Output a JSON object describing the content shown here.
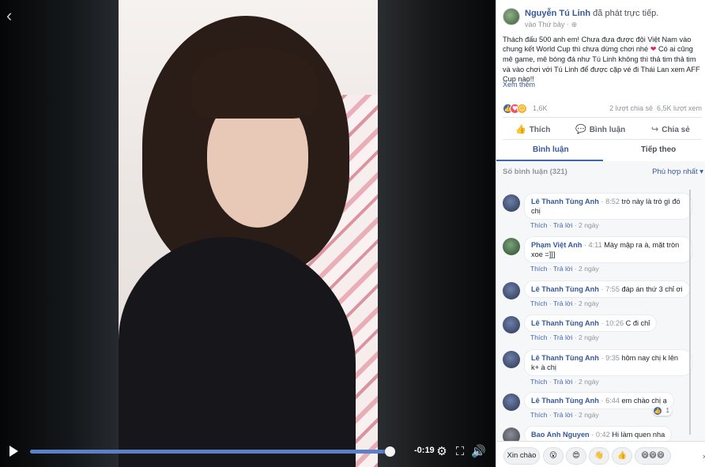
{
  "video": {
    "time_remaining": "-0:19",
    "progress_fraction": 0.98,
    "icons": [
      "back-chevron-icon",
      "play-icon",
      "settings-icon",
      "fullscreen-icon",
      "volume-icon"
    ]
  },
  "post": {
    "page_name": "Nguyễn Tú Linh",
    "action_text": "đã phát trực tiếp.",
    "posted_when": "vào Thứ bảy",
    "privacy_icon": "globe-icon",
    "text_1": "Thách đấu 500 anh em! Chưa đưa được đội Việt Nam vào chung kết World Cup thì chưa dừng chơi nhé",
    "text_2": "Có ai cũng mê game, mê bóng đá như Tú Linh không thì thả tim thả tim và vào chơi với Tú Linh để được cặp vé đi Thái Lan xem AFF Cup nào!!",
    "see_more": "Xem thêm"
  },
  "stats": {
    "reaction_count": "1,6K",
    "shares": "2 lượt chia sẻ",
    "views": "6,5K lượt xem"
  },
  "actions": {
    "like": "Thích",
    "comment": "Bình luận",
    "share": "Chia sẻ"
  },
  "tabs": {
    "comments": "Bình luận",
    "follow": "Tiếp theo"
  },
  "comments_header": {
    "count_label": "Số bình luận (321)",
    "sort_label": "Phù hợp nhất ▾"
  },
  "comments": [
    {
      "author": "Lê Thanh Tùng Anh",
      "ts": "8:52",
      "text": "trò này là trò gì đó chị",
      "like": "Thích",
      "reply": "Trả lời",
      "age": "2 ngày"
    },
    {
      "author": "Phạm Việt Anh",
      "ts": "4:11",
      "text": "Mày mập ra à, mặt tròn xoe =]]]",
      "like": "Thích",
      "reply": "Trả lời",
      "age": "2 ngày"
    },
    {
      "author": "Lê Thanh Tùng Anh",
      "ts": "7:55",
      "text": "đáp án thứ 3 chỉ ơi",
      "like": "Thích",
      "reply": "Trả lời",
      "age": "2 ngày"
    },
    {
      "author": "Lê Thanh Tùng Anh",
      "ts": "10:26",
      "text": "C đi chỉ",
      "like": "Thích",
      "reply": "Trả lời",
      "age": "2 ngày"
    },
    {
      "author": "Lê Thanh Tùng Anh",
      "ts": "9:35",
      "text": "hôm nay chị k lên k+ à chị",
      "like": "Thích",
      "reply": "Trả lời",
      "age": "2 ngày"
    },
    {
      "author": "Lê Thanh Tùng Anh",
      "ts": "6:44",
      "text": "em chào chị ạ",
      "like": "Thích",
      "reply": "Trả lời",
      "age": "2 ngày",
      "likes": "1"
    },
    {
      "author": "Bao Anh Nguyen",
      "ts": "0:42",
      "text": "Hi làm quen nha"
    }
  ],
  "quick_replies": {
    "greeting": "Xin chào",
    "emoji_icons": [
      "wow-emoji-icon",
      "love-eyes-emoji-icon",
      "wave-emoji-icon",
      "thumbs-up-emoji-icon",
      "triple-smile-emoji-icon"
    ]
  }
}
